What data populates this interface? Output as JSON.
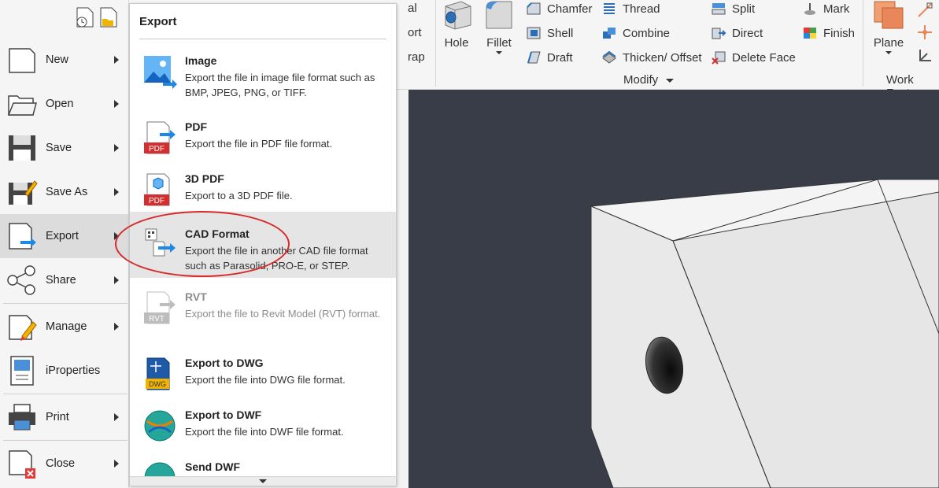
{
  "ribbon": {
    "partial_left": [
      "al",
      "ort",
      "rap"
    ],
    "hole": "Hole",
    "fillet": "Fillet",
    "col1": [
      "Chamfer",
      "Shell",
      "Draft"
    ],
    "col2": [
      "Thread",
      "Combine",
      "Thicken/ Offset"
    ],
    "col3": [
      "Split",
      "Direct",
      "Delete Face"
    ],
    "col4": [
      "Mark",
      "Finish"
    ],
    "modify_label": "Modify",
    "plane": "Plane",
    "workfeat_label": "Work Feat"
  },
  "app_menu": {
    "items": [
      {
        "label": "New",
        "icon": "new-document-icon"
      },
      {
        "label": "Open",
        "icon": "folder-open-icon"
      },
      {
        "label": "Save",
        "icon": "floppy-disk-icon"
      },
      {
        "label": "Save As",
        "icon": "save-as-icon"
      },
      {
        "label": "Export",
        "icon": "export-icon",
        "active": true
      },
      {
        "label": "Share",
        "icon": "share-icon"
      },
      {
        "label": "Manage",
        "icon": "manage-icon"
      },
      {
        "label": "iProperties",
        "icon": "iproperties-icon"
      },
      {
        "label": "Print",
        "icon": "printer-icon"
      },
      {
        "label": "Close",
        "icon": "close-document-icon"
      }
    ]
  },
  "export_panel": {
    "title": "Export",
    "items": [
      {
        "title": "Image",
        "desc": "Export the file in image file format such as BMP, JPEG, PNG, or TIFF.",
        "icon": "image-export-icon"
      },
      {
        "title": "PDF",
        "desc": "Export the file in PDF file format.",
        "icon": "pdf-icon"
      },
      {
        "title": "3D PDF",
        "desc": "Export to a 3D PDF file.",
        "icon": "3d-pdf-icon"
      },
      {
        "title": "CAD Format",
        "desc": "Export the file in another CAD file format such as Parasolid, PRO-E, or STEP.",
        "icon": "cad-format-icon",
        "active": true
      },
      {
        "title": "RVT",
        "desc": "Export the file to Revit Model (RVT) format.",
        "icon": "rvt-icon",
        "disabled": true
      },
      {
        "title": "Export to DWG",
        "desc": "Export the file into DWG file format.",
        "icon": "dwg-icon"
      },
      {
        "title": "Export to DWF",
        "desc": "Export the file into DWF file format.",
        "icon": "dwf-icon"
      },
      {
        "title": "Send DWF",
        "desc": "",
        "icon": "send-dwf-icon"
      }
    ]
  },
  "icon_texts": {
    "pdf": "PDF",
    "rvt": "RVT",
    "dwg": "DWG"
  },
  "colors": {
    "highlight_ellipse": "#d72a2a",
    "viewport_bg": "#383d47",
    "accent_blue": "#1e88e5",
    "pdf_red": "#d32f2f"
  }
}
